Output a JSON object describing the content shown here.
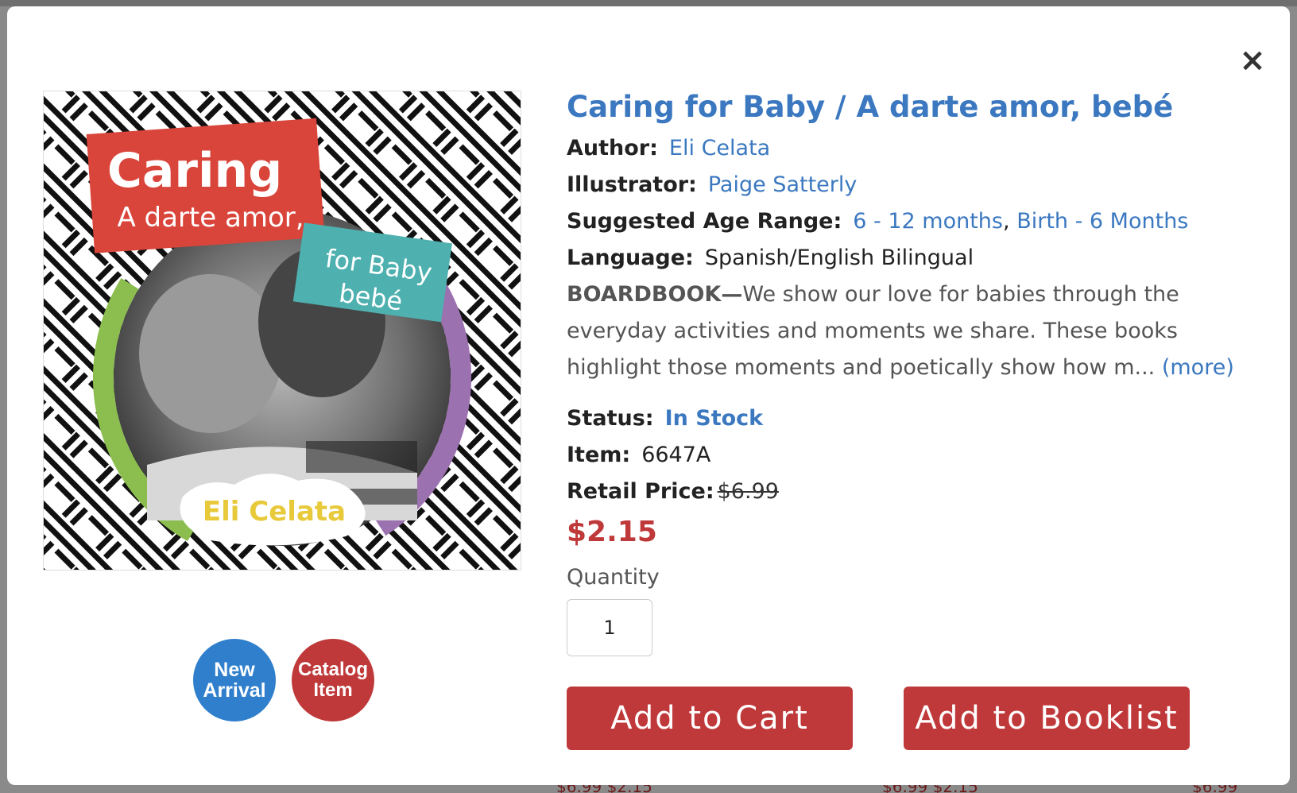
{
  "modal": {
    "close_label": "×",
    "cover": {
      "title_top": "Caring",
      "title_es": "A darte amor,",
      "title_en": "for Baby",
      "title_es2": "bebé",
      "author": "Eli Celata"
    },
    "badges": {
      "new_line1": "New",
      "new_line2": "Arrival",
      "catalog_line1": "Catalog",
      "catalog_line2": "Item"
    },
    "title": "Caring for Baby / A darte amor, bebé",
    "author_label": "Author:",
    "author": "Eli Celata",
    "illustrator_label": "Illustrator:",
    "illustrator": "Paige Satterly",
    "age_label": "Suggested Age Range:",
    "age_1": "6 - 12 months",
    "age_sep": ",",
    "age_2": "Birth - 6 Months",
    "language_label": "Language:",
    "language": "Spanish/English Bilingual",
    "desc_lead": "BOARDBOOK—",
    "desc_text": "We show our love for babies through the everyday activities and moments we share. These books highlight those moments and poetically show how m...",
    "desc_more": "(more)",
    "status_label": "Status:",
    "status": "In Stock",
    "item_label": "Item:",
    "item": "6647A",
    "retail_label": "Retail Price:",
    "retail_price": "$6.99",
    "sale_price": "$2.15",
    "quantity_label": "Quantity",
    "quantity_value": "1",
    "add_to_cart": "Add to Cart",
    "add_to_booklist": "Add to Booklist"
  },
  "background": {
    "price_fragment_1": "$6.99 $2.15",
    "price_fragment_2": "$6.99 $2.15",
    "price_fragment_3": "$6.99"
  },
  "colors": {
    "link": "#3b78c0",
    "button": "#c0393a",
    "sale": "#c0393a",
    "badge_new": "#2f7fcc",
    "badge_catalog": "#c0393a"
  }
}
